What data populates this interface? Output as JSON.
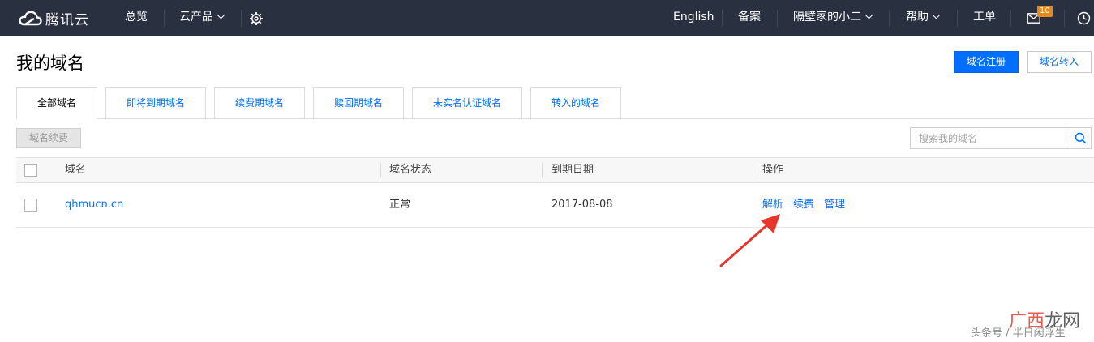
{
  "topbar": {
    "logo_text": "腾讯云",
    "nav": {
      "overview": "总览",
      "products": "云产品"
    },
    "right": {
      "language": "English",
      "filing": "备案",
      "user": "隔壁家的小二",
      "help": "帮助",
      "ticket": "工单",
      "message_count": "10"
    }
  },
  "page": {
    "title": "我的域名",
    "register_button": "域名注册",
    "transfer_button": "域名转入"
  },
  "tabs": [
    {
      "label": "全部域名",
      "active": true
    },
    {
      "label": "即将到期域名",
      "active": false
    },
    {
      "label": "续费期域名",
      "active": false
    },
    {
      "label": "赎回期域名",
      "active": false
    },
    {
      "label": "未实名认证域名",
      "active": false
    },
    {
      "label": "转入的域名",
      "active": false
    }
  ],
  "toolbar": {
    "renew_button": "域名续费",
    "search_placeholder": "搜索我的域名"
  },
  "table": {
    "columns": [
      "域名",
      "域名状态",
      "到期日期",
      "操作"
    ],
    "rows": [
      {
        "domain": "qhmucn.cn",
        "status": "正常",
        "expiry": "2017-08-08",
        "actions": [
          "解析",
          "续费",
          "管理"
        ]
      }
    ]
  },
  "watermark": {
    "logo_a": "广西",
    "logo_b": "龙网",
    "caption": "头条号 / 半日闲浮生"
  },
  "colors": {
    "topbar_bg": "#293040",
    "primary": "#006eff",
    "badge": "#e68a1f",
    "arrow": "#e8352b"
  }
}
